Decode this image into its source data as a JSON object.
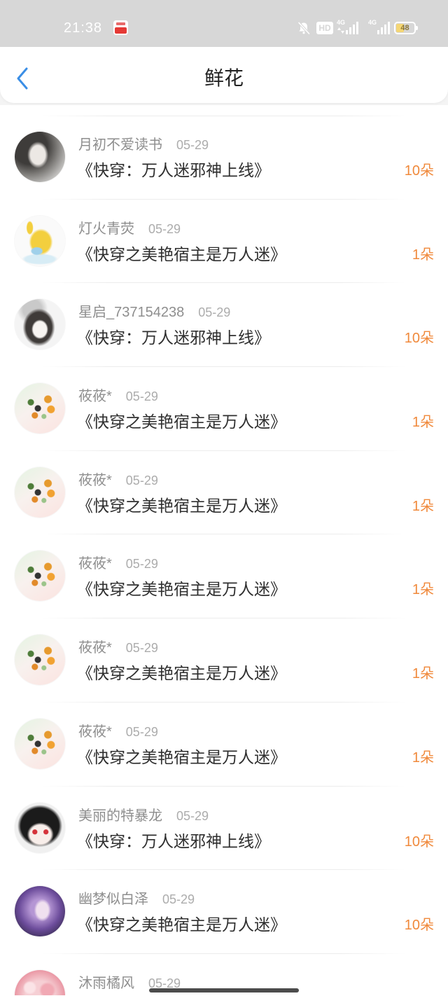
{
  "status_bar": {
    "time": "21:38",
    "hd_label": "HD",
    "sim1_network": "4G",
    "sim2_network": "4G",
    "battery_text": "48",
    "battery_level": 48,
    "icons": {
      "app": "app-notification-icon",
      "mute": "bell-off-icon",
      "data": "data-arrows-icon",
      "signal": "signal-bars-icon",
      "battery": "battery-icon"
    }
  },
  "header": {
    "back_icon": "chevron-left-icon",
    "title": "鲜花"
  },
  "theme": {
    "status_bar_bg": "#d7d7d7",
    "accent": "#3a8ee6",
    "flower_count_color": "#f0893b"
  },
  "gift_records": [
    {
      "avatar": "gray-photo-girl-avatar",
      "name": "月初不爱读书",
      "date": "05-29",
      "book": "《快穿：万人迷邪神上线》",
      "flowers": "10朵"
    },
    {
      "avatar": "pikachu-avatar",
      "name": "灯火青荧",
      "date": "05-29",
      "book": "《快穿之美艳宿主是万人迷》",
      "flowers": "1朵"
    },
    {
      "avatar": "sketch-girl-avatar",
      "name": "星启_737154238",
      "date": "05-29",
      "book": "《快穿：万人迷邪神上线》",
      "flowers": "10朵"
    },
    {
      "avatar": "pastel-emoji-avatar",
      "name": "莜莜*",
      "date": "05-29",
      "book": "《快穿之美艳宿主是万人迷》",
      "flowers": "1朵"
    },
    {
      "avatar": "pastel-emoji-avatar",
      "name": "莜莜*",
      "date": "05-29",
      "book": "《快穿之美艳宿主是万人迷》",
      "flowers": "1朵"
    },
    {
      "avatar": "pastel-emoji-avatar",
      "name": "莜莜*",
      "date": "05-29",
      "book": "《快穿之美艳宿主是万人迷》",
      "flowers": "1朵"
    },
    {
      "avatar": "pastel-emoji-avatar",
      "name": "莜莜*",
      "date": "05-29",
      "book": "《快穿之美艳宿主是万人迷》",
      "flowers": "1朵"
    },
    {
      "avatar": "pastel-emoji-avatar",
      "name": "莜莜*",
      "date": "05-29",
      "book": "《快穿之美艳宿主是万人迷》",
      "flowers": "1朵"
    },
    {
      "avatar": "black-hair-chibi-avatar",
      "name": "美丽的特暴龙",
      "date": "05-29",
      "book": "《快穿：万人迷邪神上线》",
      "flowers": "10朵"
    },
    {
      "avatar": "purple-hair-anime-avatar",
      "name": "幽梦似白泽",
      "date": "05-29",
      "book": "《快穿之美艳宿主是万人迷》",
      "flowers": "10朵"
    },
    {
      "avatar": "pink-flower-avatar",
      "name": "沐雨橘风",
      "date": "05-29"
    }
  ]
}
